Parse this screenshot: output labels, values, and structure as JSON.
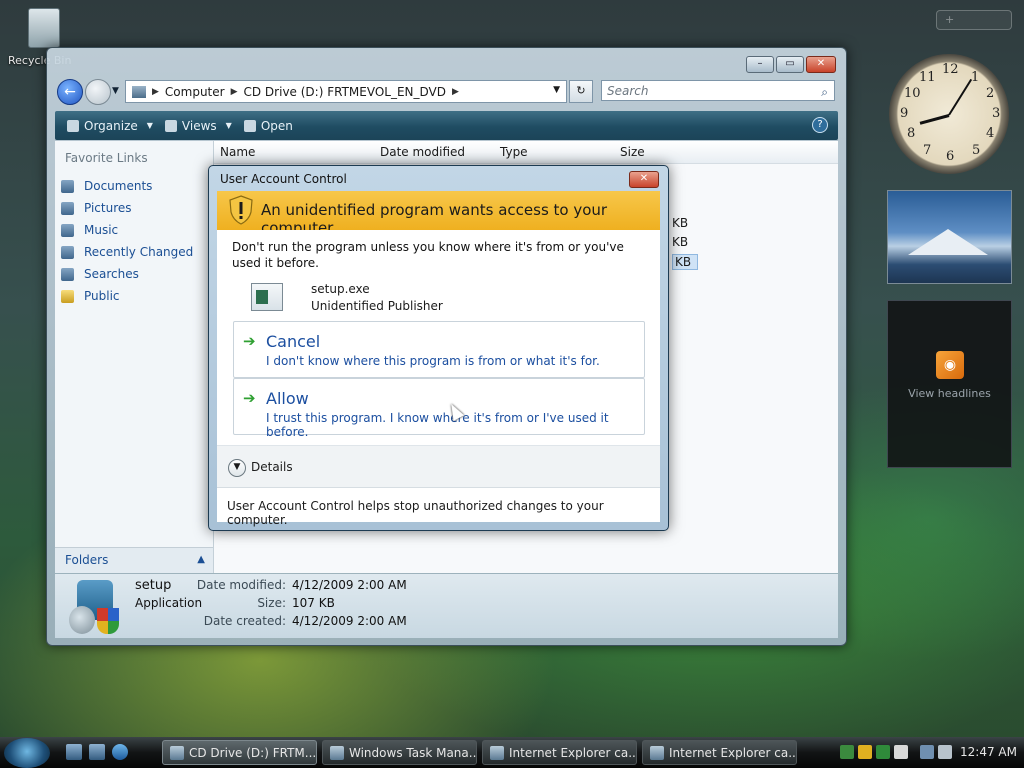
{
  "desktop": {
    "recycle_label": "Recycle Bin"
  },
  "explorer": {
    "address": [
      "Computer",
      "CD Drive (D:) FRTMEVOL_EN_DVD"
    ],
    "search_placeholder": "Search",
    "toolbar": {
      "organize": "Organize",
      "views": "Views",
      "open": "Open"
    },
    "favorite_links_header": "Favorite Links",
    "favorite_links": [
      "Documents",
      "Pictures",
      "Music",
      "Recently Changed",
      "Searches",
      "Public"
    ],
    "folders_label": "Folders",
    "columns": [
      "Name",
      "Date modified",
      "Type",
      "Size"
    ],
    "size_values": [
      "KB",
      "KB",
      "KB"
    ],
    "details": {
      "name": "setup",
      "type": "Application",
      "modified_label": "Date modified:",
      "modified": "4/12/2009 2:00 AM",
      "size_label": "Size:",
      "size": "107 KB",
      "created_label": "Date created:",
      "created": "4/12/2009 2:00 AM"
    }
  },
  "uac": {
    "title": "User Account Control",
    "banner": "An unidentified program wants access to your computer",
    "message": "Don't run the program unless you know where it's from or you've used it before.",
    "program_name": "setup.exe",
    "publisher": "Unidentified Publisher",
    "cancel_title": "Cancel",
    "cancel_desc": "I don't know where this program is from or what it's for.",
    "allow_title": "Allow",
    "allow_desc": "I trust this program. I know where it's from or I've used it before.",
    "details_label": "Details",
    "footer": "User Account Control helps stop unauthorized changes to your computer."
  },
  "sidebar": {
    "feed_label": "View headlines"
  },
  "taskbar": {
    "tasks": [
      "CD Drive (D:) FRTM...",
      "Windows Task Mana...",
      "Internet Explorer ca...",
      "Internet Explorer ca..."
    ],
    "time": "12:47 AM"
  }
}
